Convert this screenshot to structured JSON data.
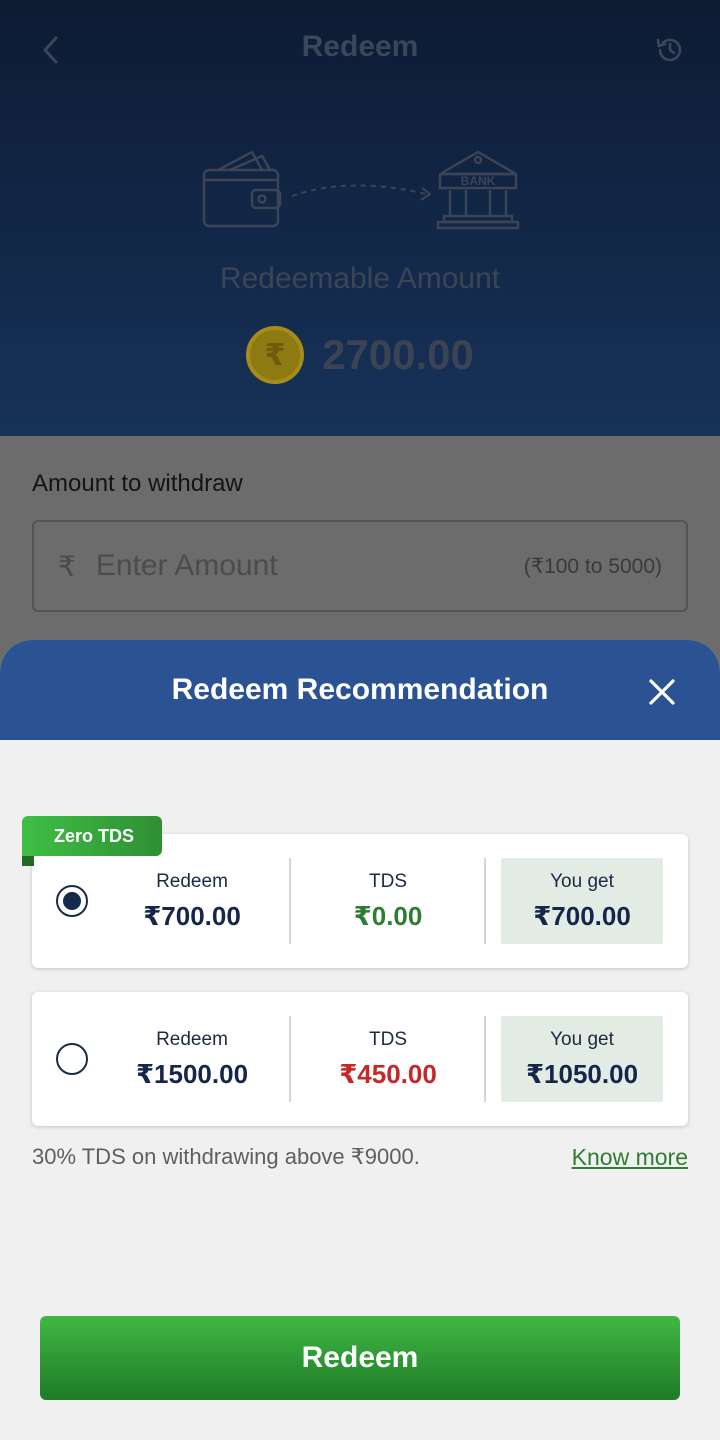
{
  "header": {
    "title": "Redeem",
    "back_icon": "chevron-left-icon",
    "history_icon": "history-icon"
  },
  "illustration": {
    "wallet_icon": "wallet-icon",
    "bank_label": "BANK"
  },
  "balance": {
    "label": "Redeemable Amount",
    "coin_symbol": "₹",
    "amount": "2700.00"
  },
  "withdraw": {
    "label": "Amount to withdraw",
    "currency_prefix": "₹",
    "placeholder": "Enter Amount",
    "range_hint": "(₹100 to 5000)"
  },
  "sheet": {
    "title": "Redeem Recommendation",
    "close_icon": "close-icon",
    "options": [
      {
        "badge": "Zero TDS",
        "selected": true,
        "redeem_label": "Redeem",
        "redeem_value": "₹700.00",
        "tds_label": "TDS",
        "tds_value": "₹0.00",
        "get_label": "You get",
        "get_value": "₹700.00"
      },
      {
        "selected": false,
        "redeem_label": "Redeem",
        "redeem_value": "₹1500.00",
        "tds_label": "TDS",
        "tds_value": "₹450.00",
        "get_label": "You get",
        "get_value": "₹1050.00"
      }
    ],
    "note": "30% TDS on withdrawing above ₹9000.",
    "know_more": "Know more",
    "redeem_button": "Redeem"
  },
  "colors": {
    "header_bg": "#13294a",
    "sheet_header": "#2b5292",
    "accent_green": "#2e7d32",
    "tds_red": "#c62828",
    "value_navy": "#14264a"
  }
}
